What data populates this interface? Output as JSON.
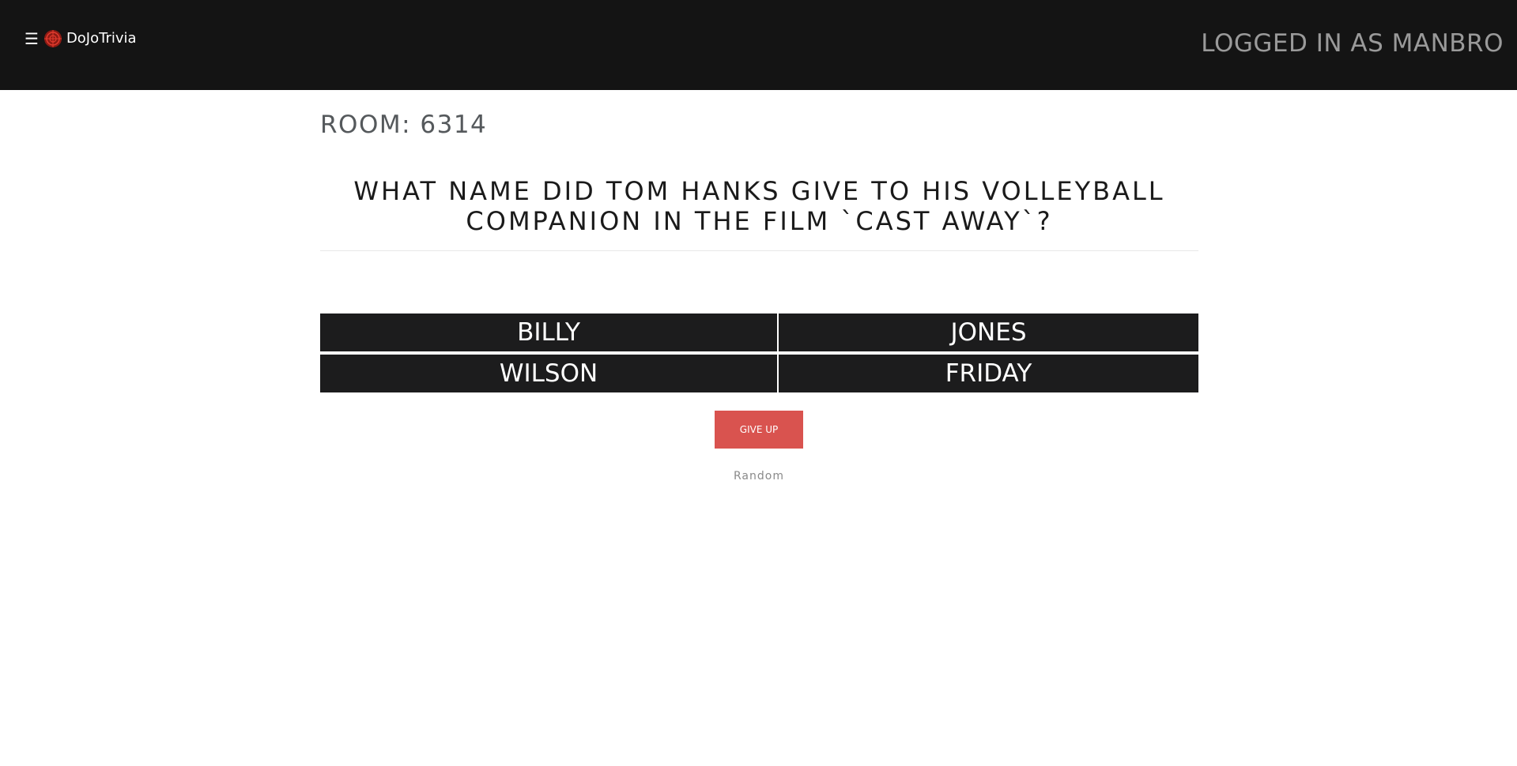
{
  "navbar": {
    "menu_icon": "☰",
    "brand_name": "DoJoTrivia",
    "logged_in_text": "LOGGED IN AS MANBRO",
    "logo_color": "#c0392b"
  },
  "room": {
    "label": "ROOM: 6314"
  },
  "question": {
    "text": "WHAT NAME DID TOM HANKS GIVE TO HIS VOLLEYBALL COMPANION IN THE FILM `CAST AWAY`?"
  },
  "answers": [
    "BILLY",
    "JONES",
    "WILSON",
    "FRIDAY"
  ],
  "actions": {
    "give_up_label": "GIVE UP",
    "give_up_color": "#d9534f"
  },
  "category": {
    "label": "Random"
  }
}
